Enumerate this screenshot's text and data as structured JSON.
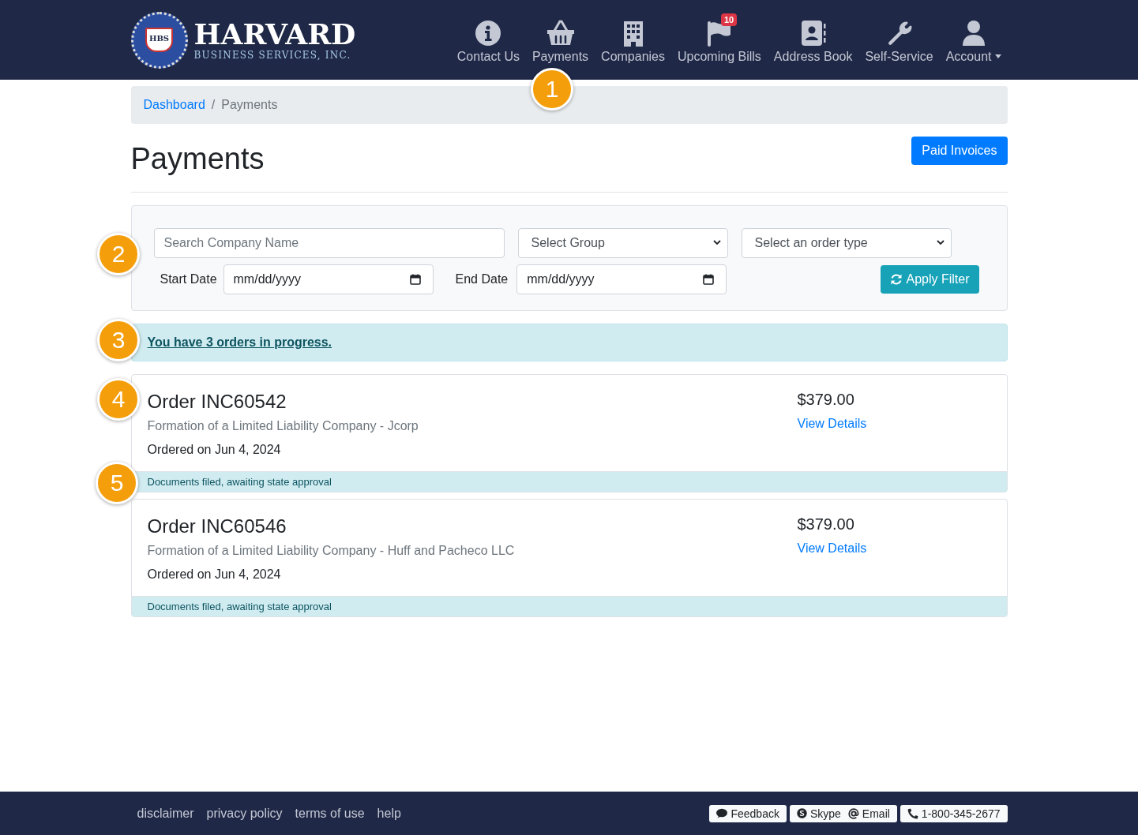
{
  "header": {
    "logo": {
      "seal_text": "HBS",
      "name": "HARVARD",
      "subtitle": "BUSINESS SERVICES, INC."
    },
    "nav": [
      {
        "label": "Contact Us",
        "kind": "info"
      },
      {
        "label": "Payments",
        "kind": "basket"
      },
      {
        "label": "Companies",
        "kind": "building"
      },
      {
        "label": "Upcoming Bills",
        "kind": "flag",
        "badge": "10"
      },
      {
        "label": "Address Book",
        "kind": "contact"
      },
      {
        "label": "Self-Service",
        "kind": "wrench"
      },
      {
        "label": "Account",
        "kind": "user",
        "dropdown": true
      }
    ]
  },
  "breadcrumb": {
    "separator": "/",
    "items": [
      {
        "label": "Dashboard",
        "kind": "link"
      },
      {
        "label": "Payments",
        "kind": "current"
      }
    ]
  },
  "page_title": "Payments",
  "paid_invoices_button": "Paid Invoices",
  "filters": {
    "search": {
      "placeholder": "Search Company Name"
    },
    "group_select": {
      "value": "Select Group"
    },
    "order_type_select": {
      "value": "Select an order type"
    },
    "start_date": {
      "label": "Start Date",
      "placeholder": "mm/dd/yyyy"
    },
    "end_date": {
      "label": "End Date",
      "placeholder": "mm/dd/yyyy"
    },
    "apply_button": "Apply Filter"
  },
  "alert": {
    "link": "You have 3 orders in progress."
  },
  "orders": [
    {
      "title": "Order INC60542",
      "description": "Formation of a Limited Liability Company - Jcorp",
      "ordered": "Ordered on Jun 4, 2024",
      "price": "$379.00",
      "link": "View Details",
      "status": "Documents filed, awaiting state approval"
    },
    {
      "title": "Order INC60546",
      "description": "Formation of a Limited Liability Company - Huff and Pacheco LLC",
      "ordered": "Ordered on Jun 4, 2024",
      "price": "$379.00",
      "link": "View Details",
      "status": "Documents filed, awaiting state approval"
    }
  ],
  "annotations": [
    "1",
    "2",
    "3",
    "4",
    "5"
  ],
  "footer": {
    "links": [
      "disclaimer",
      "privacy policy",
      "terms of use",
      "help"
    ],
    "buttons": [
      {
        "items": [
          {
            "label": "Feedback",
            "kind": "comment"
          }
        ]
      },
      {
        "items": [
          {
            "label": "Skype",
            "kind": "skype"
          },
          {
            "label": "Email",
            "kind": "at"
          }
        ]
      },
      {
        "items": [
          {
            "label": "1-800-345-2677",
            "kind": "phone"
          }
        ]
      }
    ]
  }
}
